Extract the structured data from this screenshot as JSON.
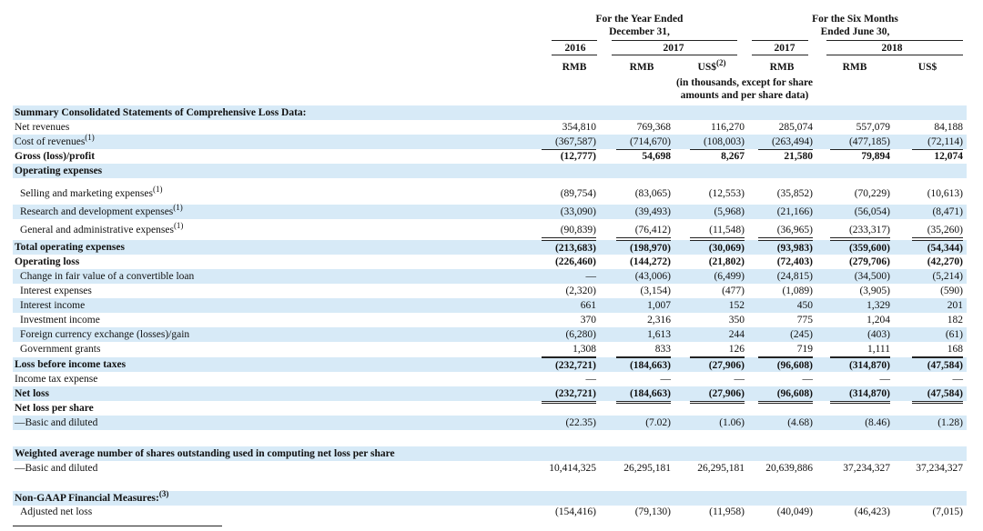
{
  "header": {
    "year_group": "For the Year Ended\nDecember 31,",
    "six_group": "For the Six Months\nEnded June 30,",
    "y2016": "2016",
    "y2017a": "2017",
    "y2017b": "2017",
    "y2018": "2018",
    "currencies": [
      "RMB",
      "RMB",
      "US$",
      "RMB",
      "RMB",
      "US$"
    ],
    "currency_note_sup": "(2)",
    "unit_note": "(in thousands, except for share\namounts and per share data)"
  },
  "rows": [
    {
      "label": "Summary Consolidated Statements of Comprehensive Loss Data:",
      "bold": true,
      "values": []
    },
    {
      "label": "Net revenues",
      "values": [
        "354,810",
        "769,368",
        "116,270",
        "285,074",
        "557,079",
        "84,188"
      ]
    },
    {
      "label": "Cost of revenues",
      "sup": "(1)",
      "values": [
        "(367,587)",
        "(714,670)",
        "(108,003)",
        "(263,494)",
        "(477,185)",
        "(72,114)"
      ]
    },
    {
      "label": "Gross (loss)/profit",
      "bold": true,
      "values": [
        "(12,777)",
        "54,698",
        "8,267",
        "21,580",
        "79,894",
        "12,074"
      ]
    },
    {
      "label": "Operating expenses",
      "bold": true,
      "values": []
    },
    {
      "label": "Selling and marketing expenses",
      "sup": "(1)",
      "values": [
        "(89,754)",
        "(83,065)",
        "(12,553)",
        "(35,852)",
        "(70,229)",
        "(10,613)"
      ]
    },
    {
      "label": "Research and development expenses",
      "sup": "(1)",
      "values": [
        "(33,090)",
        "(39,493)",
        "(5,968)",
        "(21,166)",
        "(56,054)",
        "(8,471)"
      ]
    },
    {
      "label": "General and administrative expenses",
      "sup": "(1)",
      "values": [
        "(90,839)",
        "(76,412)",
        "(11,548)",
        "(36,965)",
        "(233,317)",
        "(35,260)"
      ]
    },
    {
      "label": "Total operating expenses",
      "bold": true,
      "values": [
        "(213,683)",
        "(198,970)",
        "(30,069)",
        "(93,983)",
        "(359,600)",
        "(54,344)"
      ]
    },
    {
      "label": "Operating loss",
      "bold": true,
      "values": [
        "(226,460)",
        "(144,272)",
        "(21,802)",
        "(72,403)",
        "(279,706)",
        "(42,270)"
      ]
    },
    {
      "label": "Change in fair value of a convertible loan",
      "values": [
        "—",
        "(43,006)",
        "(6,499)",
        "(24,815)",
        "(34,500)",
        "(5,214)"
      ]
    },
    {
      "label": "Interest expenses",
      "values": [
        "(2,320)",
        "(3,154)",
        "(477)",
        "(1,089)",
        "(3,905)",
        "(590)"
      ]
    },
    {
      "label": "Interest income",
      "values": [
        "661",
        "1,007",
        "152",
        "450",
        "1,329",
        "201"
      ]
    },
    {
      "label": "Investment income",
      "values": [
        "370",
        "2,316",
        "350",
        "775",
        "1,204",
        "182"
      ]
    },
    {
      "label": "Foreign currency exchange (losses)/gain",
      "values": [
        "(6,280)",
        "1,613",
        "244",
        "(245)",
        "(403)",
        "(61)"
      ]
    },
    {
      "label": "Government grants",
      "values": [
        "1,308",
        "833",
        "126",
        "719",
        "1,111",
        "168"
      ]
    },
    {
      "label": "Loss before income taxes",
      "bold": true,
      "values": [
        "(232,721)",
        "(184,663)",
        "(27,906)",
        "(96,608)",
        "(314,870)",
        "(47,584)"
      ]
    },
    {
      "label": "Income tax expense",
      "values": [
        "—",
        "—",
        "—",
        "—",
        "—",
        "—"
      ]
    },
    {
      "label": "Net loss",
      "bold": true,
      "values": [
        "(232,721)",
        "(184,663)",
        "(27,906)",
        "(96,608)",
        "(314,870)",
        "(47,584)"
      ]
    },
    {
      "label": "Net loss per share",
      "bold": true,
      "values": []
    },
    {
      "label": "—Basic and diluted",
      "values": [
        "(22.35)",
        "(7.02)",
        "(1.06)",
        "(4.68)",
        "(8.46)",
        "(1.28)"
      ]
    },
    {
      "label": "Weighted average number of shares outstanding used in computing net loss per share",
      "bold": true,
      "values": []
    },
    {
      "label": "—Basic and diluted",
      "values": [
        "10,414,325",
        "26,295,181",
        "26,295,181",
        "20,639,886",
        "37,234,327",
        "37,234,327"
      ]
    },
    {
      "label": "Non-GAAP Financial Measures:",
      "sup": "(3)",
      "bold": true,
      "values": []
    },
    {
      "label": "Adjusted net loss",
      "values": [
        "(154,416)",
        "(79,130)",
        "(11,958)",
        "(40,049)",
        "(46,423)",
        "(7,015)"
      ]
    }
  ]
}
